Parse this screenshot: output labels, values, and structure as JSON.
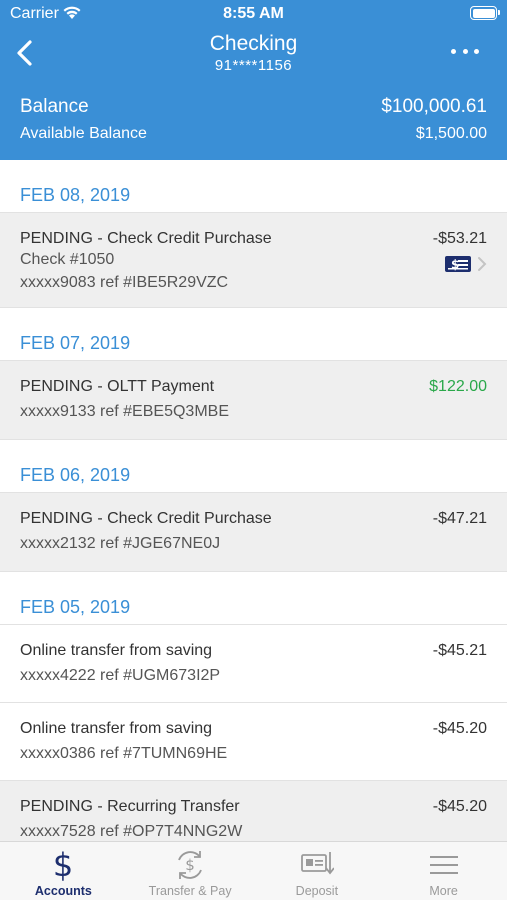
{
  "status_bar": {
    "carrier": "Carrier",
    "time": "8:55 AM"
  },
  "nav": {
    "title": "Checking",
    "account_number": "91****1156"
  },
  "balance": {
    "label": "Balance",
    "value": "$100,000.61",
    "available_label": "Available Balance",
    "available_value": "$1,500.00"
  },
  "colors": {
    "header_blue": "#3a8fd6",
    "positive_green": "#2aa84a",
    "active_tab_navy": "#1d2e6e"
  },
  "groups": [
    {
      "date": "FEB 08, 2019",
      "transactions": [
        {
          "description": "PENDING - Check Credit Purchase",
          "check": "Check #1050",
          "ref": "xxxxx9083 ref #IBE5R29VZC",
          "amount": "-$53.21"
        }
      ]
    },
    {
      "date": "FEB 07, 2019",
      "transactions": [
        {
          "description": "PENDING - OLTT Payment",
          "ref": "xxxxx9133 ref #EBE5Q3MBE",
          "amount": "$122.00"
        }
      ]
    },
    {
      "date": "FEB 06, 2019",
      "transactions": [
        {
          "description": "PENDING - Check Credit Purchase",
          "ref": "xxxxx2132 ref #JGE67NE0J",
          "amount": "-$47.21"
        }
      ]
    },
    {
      "date": "FEB 05, 2019",
      "transactions": [
        {
          "description": "Online transfer from saving",
          "ref": "xxxxx4222 ref #UGM673I2P",
          "amount": "-$45.21"
        },
        {
          "description": "Online transfer from saving",
          "ref": "xxxxx0386 ref #7TUMN69HE",
          "amount": "-$45.20"
        },
        {
          "description": "PENDING - Recurring Transfer",
          "ref": "xxxxx7528 ref #OP7T4NNG2W",
          "amount": "-$45.20"
        }
      ]
    }
  ],
  "tabs": [
    {
      "label": "Accounts",
      "icon": "dollar-icon"
    },
    {
      "label": "Transfer & Pay",
      "icon": "transfer-dollar-icon"
    },
    {
      "label": "Deposit",
      "icon": "deposit-check-icon"
    },
    {
      "label": "More",
      "icon": "menu-icon"
    }
  ]
}
